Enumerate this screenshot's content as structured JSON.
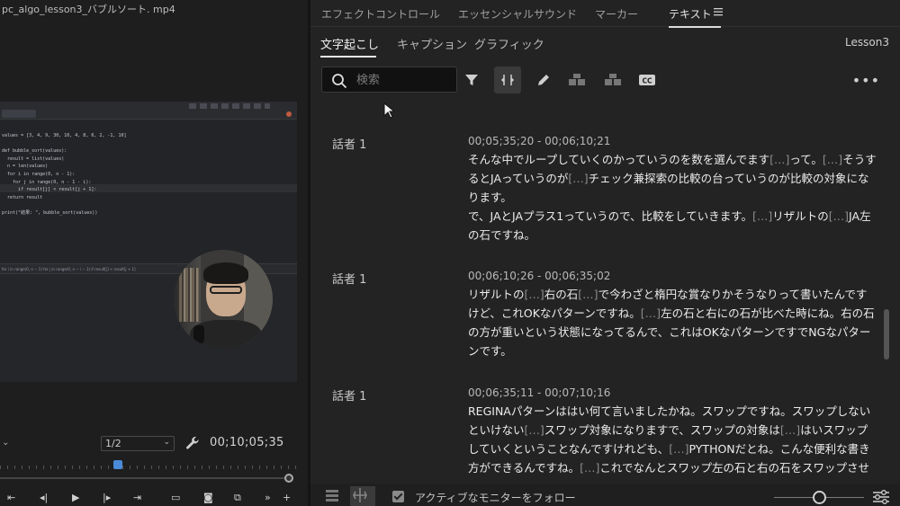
{
  "monitor": {
    "title": "pc_algo_lesson3_バブルソート. mp4",
    "quality": "1/2",
    "timecode": "00;10;05;35",
    "code_lines": [
      "values = [3, 4, 9, 30, 10, 4, 8, 6, 2, -1, 10]",
      "",
      "def bubble_sort(values):",
      "  result = list(values)",
      "  n = len(values)",
      "  for i in range(0, n - 1):",
      "    for j in range(0, n - 1 - i):",
      "      if result[j] < result[j + 1]:",
      "  return result",
      "",
      "print(\"結果: \", bubble_sort(values))"
    ],
    "ide_status": "for i in range(0, n − 1)      for j in range(0, n − i − 1)      if result[j] < result[j + 1]"
  },
  "panel_tabs": [
    "エフェクトコントロール",
    "エッセンシャルサウンド",
    "マーカー",
    "テキスト"
  ],
  "sub_tabs": [
    "文字起こし",
    "キャプション",
    "グラフィック"
  ],
  "sequence_name": "Lesson3",
  "search": {
    "placeholder": "検索",
    "value": ""
  },
  "icons": {
    "search": "search-icon",
    "filter": "filter-icon",
    "split": "split-segment-icon",
    "edit": "pencil-icon",
    "merge": "merge-segments-icon",
    "split2": "split-segments-icon",
    "captions": "cc-icon",
    "more": "more-icon",
    "menu": "hamburger-icon"
  },
  "transcript": [
    {
      "speaker": "話者 1",
      "time": "00;05;35;20 - 00;06;10;21",
      "parts": [
        [
          "そんな中でループしていくのかっていうのを数を選んでます",
          false
        ],
        [
          "[…]",
          true
        ],
        [
          "って。",
          false
        ],
        [
          "[…]",
          true
        ],
        [
          "そうするとJAっていうのが",
          false
        ],
        [
          "[…]",
          true
        ],
        [
          "チェック兼探索の比較の台っていうのが比較の対象になります。",
          false
        ],
        [
          "\nで、JAとJAプラス1っていうので、比較をしていきます。",
          false
        ],
        [
          "[…]",
          true
        ],
        [
          "リザルトの",
          false
        ],
        [
          "[…]",
          true
        ],
        [
          "JA左の石ですね。",
          false
        ]
      ]
    },
    {
      "speaker": "話者 1",
      "time": "00;06;10;26 - 00;06;35;02",
      "parts": [
        [
          "リザルトの",
          false
        ],
        [
          "[…]",
          true
        ],
        [
          "右の石",
          false
        ],
        [
          "[…]",
          true
        ],
        [
          "で今わざと楕円な賞なりかそうなりって書いたんですけど、これOKなパターンですね。",
          false
        ],
        [
          "[…]",
          true
        ],
        [
          "左の石と右にの石が比べた時にね。右の石の方が重いという状態になってるんで、これはOKなパターンですでNGなパターンです。",
          false
        ]
      ]
    },
    {
      "speaker": "話者 1",
      "time": "00;06;35;11 - 00;07;10;16",
      "parts": [
        [
          "REGINAパターンははい何て言いましたかね。スワップですね。スワップしないといけない",
          false
        ],
        [
          "[…]",
          true
        ],
        [
          "スワップ対象になりますで、スワップの対象は",
          false
        ],
        [
          "[…]",
          true
        ],
        [
          "はいスワップしていくということなんですけれども、",
          false
        ],
        [
          "[…]",
          true
        ],
        [
          "PYTHONだとね。こんな便利な書き方ができるんですね。",
          false
        ],
        [
          "[…]",
          true
        ],
        [
          "これでなんとスワップ左の石と右の石をスワップさせることができるで、カンマとイコールで繋",
          false
        ]
      ]
    }
  ],
  "footer": {
    "follow_label": "アクティブなモニターをフォロー",
    "follow_checked": true,
    "zoom_level": 0.5
  },
  "colors": {
    "panel_bg": "#232323",
    "accent_blue": "#4a8ad8",
    "text_dim": "#8d8d8d"
  }
}
